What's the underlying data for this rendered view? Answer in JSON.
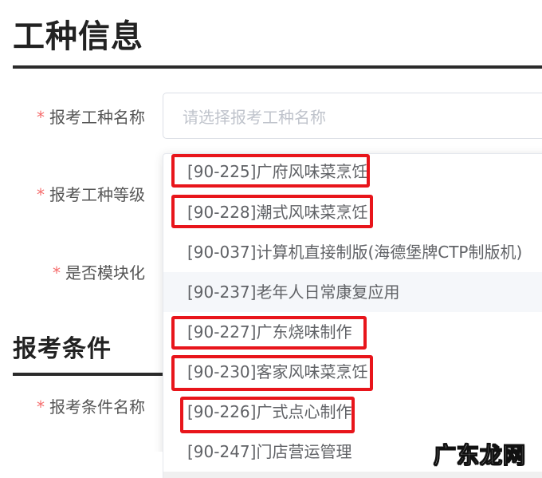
{
  "sections": {
    "job_info_title": "工种信息",
    "exam_conditions_title": "报考条件"
  },
  "form": {
    "required_mark": "*",
    "job_name_label": "报考工种名称",
    "job_level_label": "报考工种等级",
    "modular_label": "是否模块化",
    "condition_name_label": "报考条件名称",
    "job_name_placeholder": "请选择报考工种名称"
  },
  "dropdown": {
    "options": [
      {
        "label": "[90-225]广府风味菜烹饪",
        "highlighted": true
      },
      {
        "label": "[90-228]潮式风味菜烹饪",
        "highlighted": true
      },
      {
        "label": "[90-037]计算机直接制版(海德堡牌CTP制版机)",
        "highlighted": false
      },
      {
        "label": "[90-237]老年人日常康复应用",
        "highlighted": false,
        "hover": true
      },
      {
        "label": "[90-227]广东烧味制作",
        "highlighted": true
      },
      {
        "label": "[90-230]客家风味菜烹饪",
        "highlighted": true
      },
      {
        "label": "[90-226]广式点心制作",
        "highlighted": true
      },
      {
        "label": "[90-247]门店营运管理",
        "highlighted": false
      }
    ],
    "highlight_color": "#e8151b"
  },
  "watermark": "广东龙网"
}
